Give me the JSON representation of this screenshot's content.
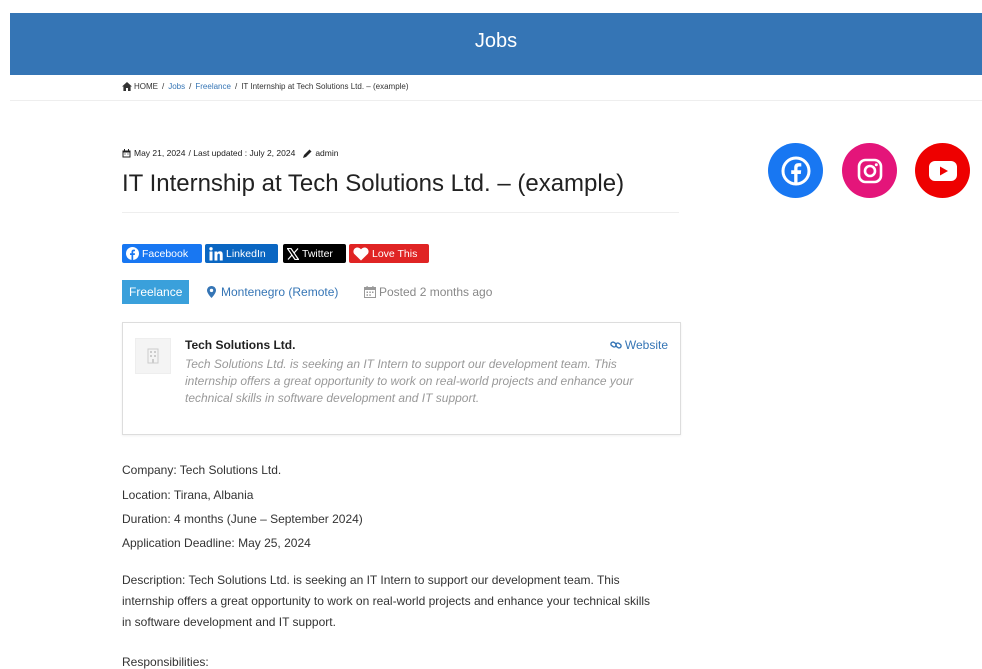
{
  "header": {
    "title": "Jobs"
  },
  "breadcrumb": {
    "items": [
      "HOME",
      "Jobs",
      "Freelance"
    ],
    "current": "IT Internship at Tech Solutions Ltd. – (example)",
    "separator": "/"
  },
  "meta": {
    "date": "May 21, 2024",
    "last_updated": "/ Last updated : July 2, 2024",
    "author": "admin"
  },
  "title": "IT Internship at Tech Solutions Ltd. – (example)",
  "share": {
    "facebook": "Facebook",
    "linkedin": "LinkedIn",
    "twitter": "Twitter",
    "love": "Love This"
  },
  "job": {
    "type": "Freelance",
    "location": "Montenegro (Remote)",
    "posted": "Posted 2 months ago"
  },
  "company": {
    "name": "Tech Solutions Ltd.",
    "website_label": "Website",
    "description": "Tech Solutions Ltd. is seeking an IT Intern to support our development team. This internship offers a great opportunity to work on real-world projects and enhance your technical skills in software development and IT support."
  },
  "details": {
    "company": "Company: Tech Solutions Ltd.",
    "location": "Location: Tirana, Albania",
    "duration": "Duration: 4 months (June – September 2024)",
    "deadline": "Application Deadline: May 25, 2024",
    "description": "Description: Tech Solutions Ltd. is seeking an IT Intern to support our development team. This internship offers a great opportunity to work on real-world projects and enhance your technical skills in software development and IT support.",
    "responsibilities": "Responsibilities:"
  },
  "colors": {
    "header": "#3575b5",
    "tag": "#3aa0db",
    "facebook": "#1877f2",
    "linkedin": "#0a66c2",
    "twitter": "#000000",
    "love": "#e02424",
    "instagram": "#e4157a",
    "youtube": "#ee0000"
  },
  "icons": {
    "breadcrumb": "home-icon",
    "meta_date": "calendar-icon",
    "meta_author": "pencil-icon",
    "location": "map-pin-icon",
    "posted": "calendar-icon",
    "website": "link-icon",
    "social": [
      "facebook-icon",
      "instagram-icon",
      "youtube-icon"
    ]
  }
}
